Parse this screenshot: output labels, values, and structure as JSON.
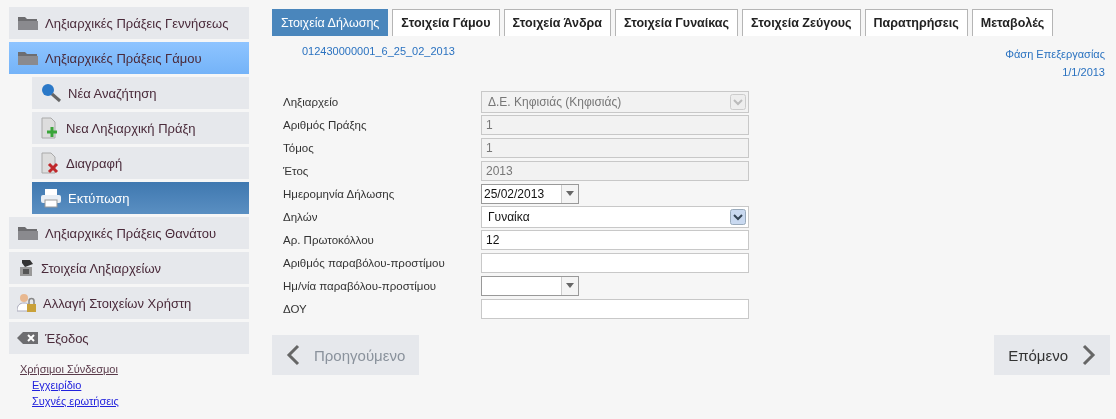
{
  "sidebar": {
    "items": [
      {
        "label": "Ληξιαρχικές Πράξεις Γεννήσεως",
        "expanded": false
      },
      {
        "label": "Ληξιαρχικές Πράξεις Γάμου",
        "expanded": true,
        "children": [
          {
            "label": "Νέα Αναζήτηση",
            "selected": false
          },
          {
            "label": "Νεα Ληξιαρχική Πράξη",
            "selected": false
          },
          {
            "label": "Διαγραφή",
            "selected": false
          },
          {
            "label": "Εκτύπωση",
            "selected": true
          }
        ]
      },
      {
        "label": "Ληξιαρχικές Πράξεις Θανάτου",
        "expanded": false
      },
      {
        "label": "Στοιχεία Ληξιαρχείων",
        "expanded": false
      },
      {
        "label": "Αλλαγή Στοιχείων Χρήστη",
        "expanded": false
      },
      {
        "label": "Έξοδος",
        "expanded": false
      }
    ],
    "links": {
      "title": "Χρήσιμοι Σύνδεσμοι",
      "items": [
        "Εγχειρίδιο",
        "Συχνές ερωτήσεις"
      ]
    }
  },
  "tabs": [
    {
      "label": "Στοιχεία Δήλωσης",
      "selected": true
    },
    {
      "label": "Στοιχεία Γάμου",
      "selected": false
    },
    {
      "label": "Στοιχεία Άνδρα",
      "selected": false
    },
    {
      "label": "Στοιχεία Γυναίκας",
      "selected": false
    },
    {
      "label": "Στοιχεία Ζεύγους",
      "selected": false
    },
    {
      "label": "Παρατηρήσεις",
      "selected": false
    },
    {
      "label": "Μεταβολές",
      "selected": false
    }
  ],
  "record_id": "012430000001_6_25_02_2013",
  "phase": {
    "label": "Φάση Επεξεργασίας",
    "date": "1/1/2013"
  },
  "form": [
    {
      "label": "Ληξιαρχείο",
      "kind": "select",
      "value": "Δ.Ε. Κηφισιάς (Κηφισιάς)",
      "disabled": true
    },
    {
      "label": "Αριθμός Πράξης",
      "kind": "text",
      "value": "1",
      "disabled": true
    },
    {
      "label": "Τόμος",
      "kind": "text",
      "value": "1",
      "disabled": true
    },
    {
      "label": "Έτος",
      "kind": "text",
      "value": "2013",
      "disabled": true
    },
    {
      "label": "Ημερομηνία Δήλωσης",
      "kind": "date",
      "value": "25/02/2013",
      "disabled": false
    },
    {
      "label": "Δηλών",
      "kind": "select",
      "value": "Γυναίκα",
      "disabled": false
    },
    {
      "label": "Αρ. Πρωτοκόλλου",
      "kind": "text",
      "value": "12",
      "disabled": false
    },
    {
      "label": "Αριθμός παραβόλου-προστίμου",
      "kind": "text",
      "disabled": false
    },
    {
      "label": "Ημ/νία παραβόλου-προστίμου",
      "kind": "date",
      "disabled": false
    },
    {
      "label": "ΔΟΥ",
      "kind": "text",
      "disabled": false
    }
  ],
  "nav": {
    "previous": {
      "label": "Προηγούμενο",
      "disabled": true
    },
    "next": {
      "label": "Επόμενο",
      "disabled": false
    }
  }
}
